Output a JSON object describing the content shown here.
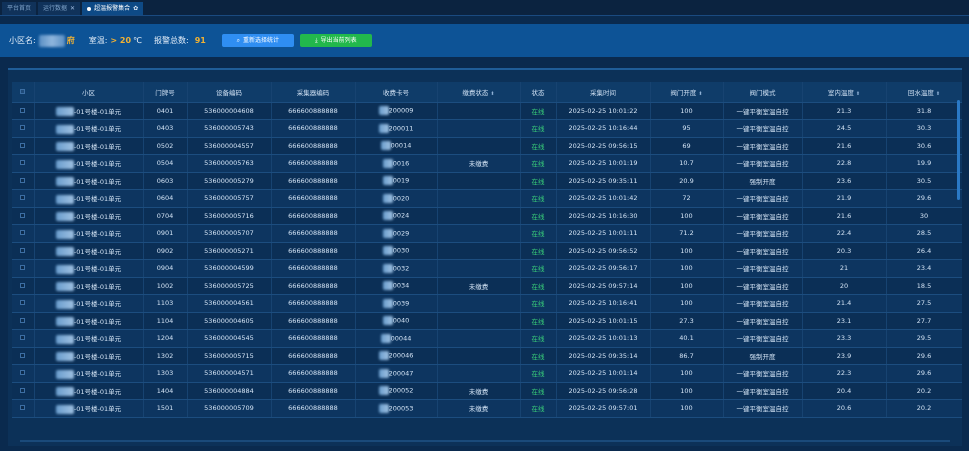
{
  "tabs": [
    {
      "label": "平台首页",
      "active": false,
      "closable": false
    },
    {
      "label": "运行数据",
      "active": false,
      "closable": true
    },
    {
      "label": "超温报警集合",
      "active": true,
      "closable": true
    }
  ],
  "filter": {
    "community_label": "小区名:",
    "community_value_suffix": "府",
    "temp_label": "室温:",
    "temp_value": "> 20",
    "temp_unit": "℃",
    "alarm_label": "报警总数:",
    "alarm_count": "91",
    "reselect_button": "重新选择统计",
    "export_button": "导出当前列表"
  },
  "table": {
    "headers": [
      "小区",
      "门牌号",
      "设备编码",
      "采集器编码",
      "收费卡号",
      "缴费状态",
      "状态",
      "采集时间",
      "阀门开度",
      "阀门模式",
      "室内温度",
      "回水温度"
    ],
    "rows": [
      {
        "unit": "-01号楼-01单元",
        "door": "0401",
        "device": "536000004608",
        "collector": "666600888888",
        "card": "200009",
        "pay": "",
        "status": "在线",
        "time": "2025-02-25 10:01:22",
        "valve": "100",
        "mode": "一键平衡室温自控",
        "indoor": "21.3",
        "return": "31.8"
      },
      {
        "unit": "-01号楼-01单元",
        "door": "0403",
        "device": "536000005743",
        "collector": "666600888888",
        "card": "200011",
        "pay": "",
        "status": "在线",
        "time": "2025-02-25 10:16:44",
        "valve": "95",
        "mode": "一键平衡室温自控",
        "indoor": "24.5",
        "return": "30.3"
      },
      {
        "unit": "-01号楼-01单元",
        "door": "0502",
        "device": "536000004557",
        "collector": "666600888888",
        "card": "00014",
        "pay": "",
        "status": "在线",
        "time": "2025-02-25 09:56:15",
        "valve": "69",
        "mode": "一键平衡室温自控",
        "indoor": "21.6",
        "return": "30.6"
      },
      {
        "unit": "-01号楼-01单元",
        "door": "0504",
        "device": "536000005763",
        "collector": "666600888888",
        "card": "0016",
        "pay": "未缴费",
        "status": "在线",
        "time": "2025-02-25 10:01:19",
        "valve": "10.7",
        "mode": "一键平衡室温自控",
        "indoor": "22.8",
        "return": "19.9"
      },
      {
        "unit": "-01号楼-01单元",
        "door": "0603",
        "device": "536000005279",
        "collector": "666600888888",
        "card": "0019",
        "pay": "",
        "status": "在线",
        "time": "2025-02-25 09:35:11",
        "valve": "20.9",
        "mode": "强制开度",
        "indoor": "23.6",
        "return": "30.5"
      },
      {
        "unit": "-01号楼-01单元",
        "door": "0604",
        "device": "536000005757",
        "collector": "666600888888",
        "card": "0020",
        "pay": "",
        "status": "在线",
        "time": "2025-02-25 10:01:42",
        "valve": "72",
        "mode": "一键平衡室温自控",
        "indoor": "21.9",
        "return": "29.6"
      },
      {
        "unit": "-01号楼-01单元",
        "door": "0704",
        "device": "536000005716",
        "collector": "666600888888",
        "card": "0024",
        "pay": "",
        "status": "在线",
        "time": "2025-02-25 10:16:30",
        "valve": "100",
        "mode": "一键平衡室温自控",
        "indoor": "21.6",
        "return": "30"
      },
      {
        "unit": "-01号楼-01单元",
        "door": "0901",
        "device": "536000005707",
        "collector": "666600888888",
        "card": "0029",
        "pay": "",
        "status": "在线",
        "time": "2025-02-25 10:01:11",
        "valve": "71.2",
        "mode": "一键平衡室温自控",
        "indoor": "22.4",
        "return": "28.5"
      },
      {
        "unit": "-01号楼-01单元",
        "door": "0902",
        "device": "536000005271",
        "collector": "666600888888",
        "card": "0030",
        "pay": "",
        "status": "在线",
        "time": "2025-02-25 09:56:52",
        "valve": "100",
        "mode": "一键平衡室温自控",
        "indoor": "20.3",
        "return": "26.4"
      },
      {
        "unit": "-01号楼-01单元",
        "door": "0904",
        "device": "536000004599",
        "collector": "666600888888",
        "card": "0032",
        "pay": "",
        "status": "在线",
        "time": "2025-02-25 09:56:17",
        "valve": "100",
        "mode": "一键平衡室温自控",
        "indoor": "21",
        "return": "23.4"
      },
      {
        "unit": "-01号楼-01单元",
        "door": "1002",
        "device": "536000005725",
        "collector": "666600888888",
        "card": "0034",
        "pay": "未缴费",
        "status": "在线",
        "time": "2025-02-25 09:57:14",
        "valve": "100",
        "mode": "一键平衡室温自控",
        "indoor": "20",
        "return": "18.5"
      },
      {
        "unit": "-01号楼-01单元",
        "door": "1103",
        "device": "536000004561",
        "collector": "666600888888",
        "card": "0039",
        "pay": "",
        "status": "在线",
        "time": "2025-02-25 10:16:41",
        "valve": "100",
        "mode": "一键平衡室温自控",
        "indoor": "21.4",
        "return": "27.5"
      },
      {
        "unit": "-01号楼-01单元",
        "door": "1104",
        "device": "536000004605",
        "collector": "666600888888",
        "card": "0040",
        "pay": "",
        "status": "在线",
        "time": "2025-02-25 10:01:15",
        "valve": "27.3",
        "mode": "一键平衡室温自控",
        "indoor": "23.1",
        "return": "27.7"
      },
      {
        "unit": "-01号楼-01单元",
        "door": "1204",
        "device": "536000004545",
        "collector": "666600888888",
        "card": "00044",
        "pay": "",
        "status": "在线",
        "time": "2025-02-25 10:01:13",
        "valve": "40.1",
        "mode": "一键平衡室温自控",
        "indoor": "23.3",
        "return": "29.5"
      },
      {
        "unit": "-01号楼-01单元",
        "door": "1302",
        "device": "536000005715",
        "collector": "666600888888",
        "card": "200046",
        "pay": "",
        "status": "在线",
        "time": "2025-02-25 09:35:14",
        "valve": "86.7",
        "mode": "强制开度",
        "indoor": "23.9",
        "return": "29.6"
      },
      {
        "unit": "-01号楼-01单元",
        "door": "1303",
        "device": "536000004571",
        "collector": "666600888888",
        "card": "200047",
        "pay": "",
        "status": "在线",
        "time": "2025-02-25 10:01:14",
        "valve": "100",
        "mode": "一键平衡室温自控",
        "indoor": "22.3",
        "return": "29.6"
      },
      {
        "unit": "-01号楼-01单元",
        "door": "1404",
        "device": "536000004884",
        "collector": "666600888888",
        "card": "200052",
        "pay": "未缴费",
        "status": "在线",
        "time": "2025-02-25 09:56:28",
        "valve": "100",
        "mode": "一键平衡室温自控",
        "indoor": "20.4",
        "return": "20.2"
      },
      {
        "unit": "-01号楼-01单元",
        "door": "1501",
        "device": "536000005709",
        "collector": "666600888888",
        "card": "200053",
        "pay": "未缴费",
        "status": "在线",
        "time": "2025-02-25 09:57:01",
        "valve": "100",
        "mode": "一键平衡室温自控",
        "indoor": "20.6",
        "return": "20.2"
      }
    ]
  },
  "colors": {
    "online": "#3ad17a",
    "highlight": "#f2b233",
    "primary_button": "#2f8ef2",
    "export_button": "#22b84c"
  }
}
